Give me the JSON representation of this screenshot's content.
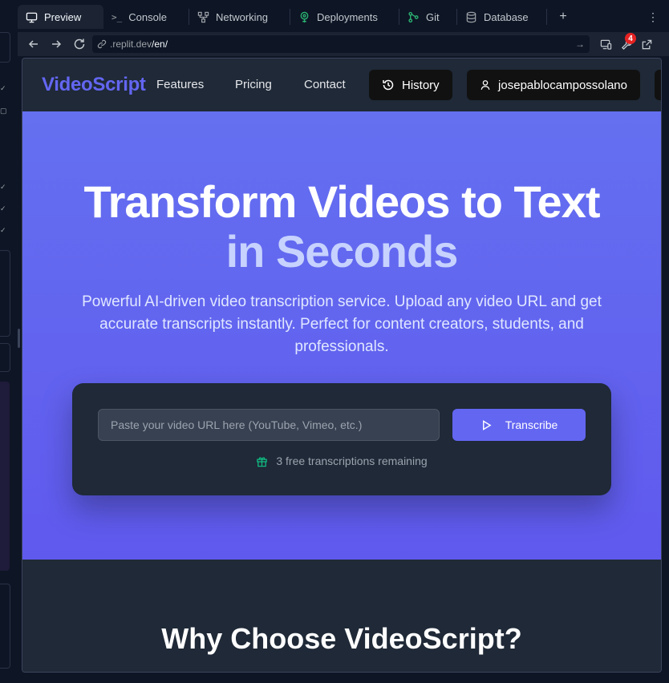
{
  "tabs": [
    {
      "label": "Preview",
      "icon": "monitor-icon",
      "active": true
    },
    {
      "label": "Console",
      "icon": "terminal-icon"
    },
    {
      "label": "Networking",
      "icon": "network-icon"
    },
    {
      "label": "Deployments",
      "icon": "deploy-icon"
    },
    {
      "label": "Git",
      "icon": "git-icon"
    },
    {
      "label": "Database",
      "icon": "database-icon"
    }
  ],
  "tab_actions": {
    "add": "+",
    "more": "⋮"
  },
  "address": {
    "host": ".replit.dev",
    "path": "/en/",
    "go": "→",
    "notifications": "4"
  },
  "site": {
    "logo": "VideoScript",
    "nav": {
      "features": "Features",
      "pricing": "Pricing",
      "contact": "Contact",
      "history": "History",
      "user": "josepablocampossolano"
    },
    "hero": {
      "title_line1": "Transform Videos to Text",
      "title_line2": "in Seconds",
      "subtitle": "Powerful AI-driven video transcription service. Upload any video URL and get accurate transcripts instantly. Perfect for content creators, students, and professionals.",
      "url_placeholder": "Paste your video URL here (YouTube, Vimeo, etc.)",
      "cta": "Transcribe",
      "remaining": "3 free transcriptions remaining"
    },
    "why_title": "Why Choose VideoScript?"
  },
  "colors": {
    "brand": "#6366f1",
    "hero_bg": "#6366f1",
    "title_accent": "#c7d2fe",
    "gift": "#10b981"
  }
}
